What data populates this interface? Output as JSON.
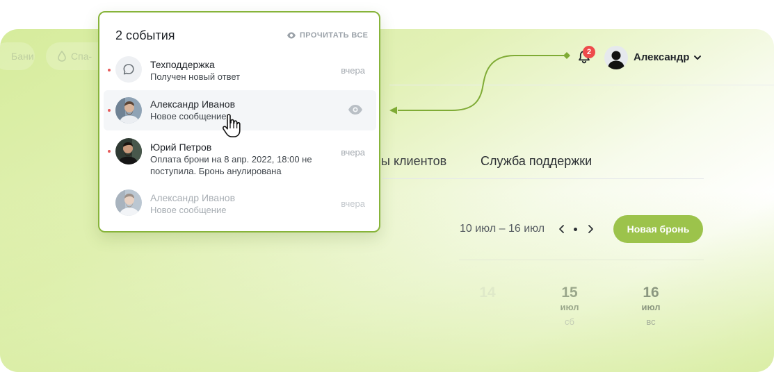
{
  "nav": {
    "chips": [
      {
        "label": "Бани"
      },
      {
        "label": "Спа-",
        "icon": "drop-icon"
      }
    ]
  },
  "header": {
    "notification_count": "2",
    "user_name": "Александр"
  },
  "tabs": [
    {
      "label": "ы клиентов"
    },
    {
      "label": "Служба поддержки"
    }
  ],
  "schedule": {
    "date_range": "10 июл – 16 июл",
    "new_booking_label": "Новая бронь",
    "days": [
      {
        "num": "14",
        "month": "",
        "weekday": ""
      },
      {
        "num": "15",
        "month": "июл",
        "weekday": "сб"
      },
      {
        "num": "16",
        "month": "июл",
        "weekday": "вс"
      }
    ]
  },
  "notifications": {
    "title": "2 события",
    "read_all_label": "ПРОЧИТАТЬ ВСЕ",
    "items": [
      {
        "name": "Техподдержка",
        "text": "Получен новый ответ",
        "time": "вчера",
        "unread": true,
        "avatar": "chat-icon"
      },
      {
        "name": "Александр Иванов",
        "text": "Новое сообщение",
        "time": "",
        "unread": true,
        "avatar": "photo"
      },
      {
        "name": "Юрий Петров",
        "text": "Оплата брони на 8 апр. 2022, 18:00 не поступила. Бронь анулирована",
        "time": "вчера",
        "unread": true,
        "avatar": "photo"
      },
      {
        "name": "Александр Иванов",
        "text": "Новое сообщение",
        "time": "вчера",
        "unread": false,
        "avatar": "photo"
      }
    ]
  },
  "colors": {
    "accent": "#9cc34b",
    "popup_border": "#87b43a",
    "badge": "#ee4b4b",
    "unread_dot": "#e65a5a"
  }
}
